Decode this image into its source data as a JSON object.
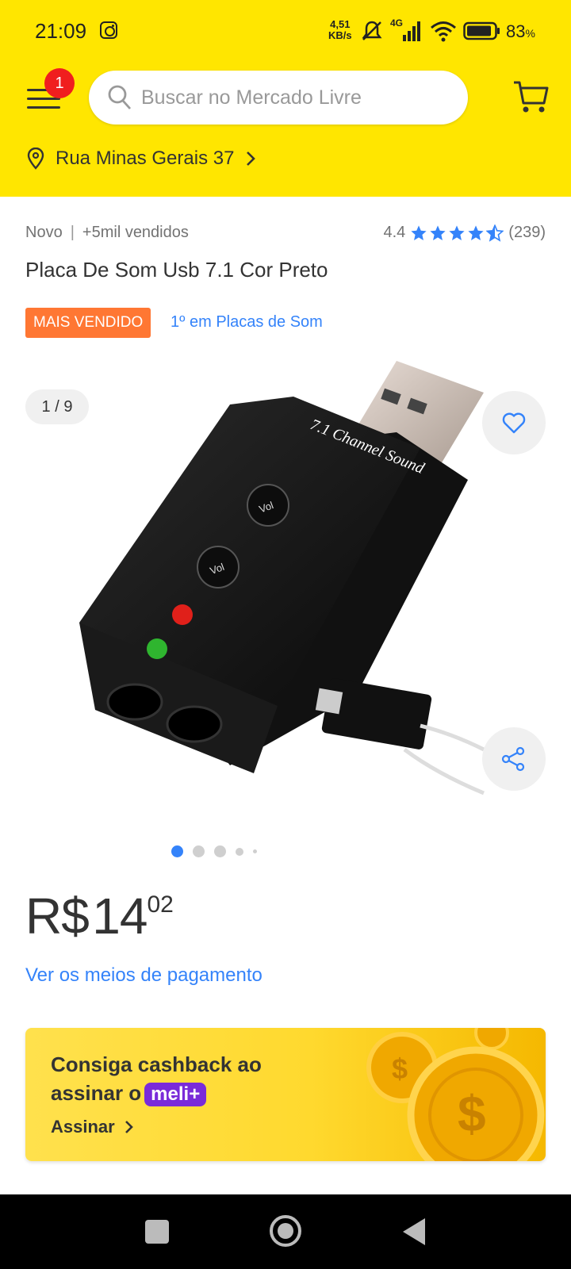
{
  "status_bar": {
    "time": "21:09",
    "net_speed_value": "4,51",
    "net_speed_unit": "KB/s",
    "network": "4G",
    "battery": "83",
    "battery_unit": "%"
  },
  "header": {
    "menu_badge": "1",
    "search_placeholder": "Buscar no Mercado Livre",
    "location": "Rua Minas Gerais 37"
  },
  "product": {
    "condition": "Novo",
    "sold": "+5mil vendidos",
    "rating_value": "4.4",
    "rating_stars": 4.4,
    "rating_count": "(239)",
    "title": "Placa De Som Usb 7.1 Cor Preto",
    "tag": "MAIS VENDIDO",
    "tag_link": "1º em Placas de Som",
    "image_label": "7.1 Channel Sound"
  },
  "gallery": {
    "counter": "1 / 9"
  },
  "price": {
    "currency": "R$",
    "integer": "14",
    "cents": "02",
    "payment_link": "Ver os meios de pagamento"
  },
  "banner": {
    "line1": "Consiga cashback ao",
    "line2": "assinar o",
    "brand": "meli+",
    "cta": "Assinar"
  },
  "colors": {
    "brand_yellow": "#ffe600",
    "link_blue": "#3483fa",
    "tag_orange": "#ff7733",
    "meli_purple": "#7a2bd9"
  },
  "icons": [
    "instagram-icon",
    "mute-icon",
    "signal-icon",
    "wifi-icon",
    "battery-icon",
    "menu-icon",
    "search-icon",
    "cart-icon",
    "location-pin-icon",
    "chevron-right-icon",
    "star-icon",
    "heart-icon",
    "share-icon"
  ]
}
